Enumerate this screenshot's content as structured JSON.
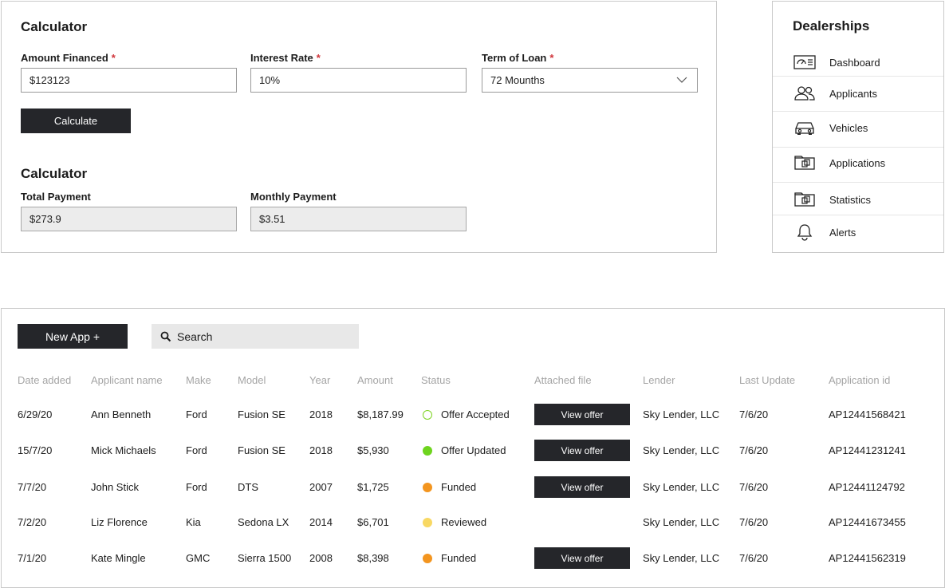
{
  "calculator": {
    "title": "Calculator",
    "amount_financed": {
      "label": "Amount Financed",
      "required_mark": "*",
      "value": "$123123"
    },
    "interest_rate": {
      "label": "Interest Rate",
      "required_mark": "*",
      "value": "10%"
    },
    "term_of_loan": {
      "label": "Term of Loan",
      "required_mark": "*",
      "value": "72 Mounths"
    },
    "calculate_label": "Calculate",
    "results_title": "Calculator",
    "total_payment": {
      "label": "Total Payment",
      "value": "$273.9"
    },
    "monthly_payment": {
      "label": "Monthly Payment",
      "value": "$3.51"
    }
  },
  "dealerships": {
    "title": "Dealerships",
    "items": [
      {
        "label": "Dashboard",
        "icon": "dashboard-icon"
      },
      {
        "label": "Applicants",
        "icon": "users-icon"
      },
      {
        "label": "Vehicles",
        "icon": "car-icon"
      },
      {
        "label": "Applications",
        "icon": "folder-icon"
      },
      {
        "label": "Statistics",
        "icon": "folder-icon"
      },
      {
        "label": "Alerts",
        "icon": "bell-icon"
      }
    ]
  },
  "applications": {
    "new_app_label": "New App +",
    "search_placeholder": "Search",
    "columns": [
      "Date added",
      "Applicant name",
      "Make",
      "Model",
      "Year",
      "Amount",
      "Status",
      "Attached file",
      "Lender",
      "Last Update",
      "Application id"
    ],
    "view_offer_label": "View offer",
    "rows": [
      {
        "date": "6/29/20",
        "name": "Ann Benneth",
        "make": "Ford",
        "model": "Fusion SE",
        "year": "2018",
        "amount": "$8,187.99",
        "status": "Offer Accepted",
        "status_color": "#7ed321",
        "status_style": "outline",
        "has_file": true,
        "lender": "Sky Lender, LLC",
        "updated": "7/6/20",
        "app_id": "AP12441568421"
      },
      {
        "date": "15/7/20",
        "name": "Mick Michaels",
        "make": "Ford",
        "model": "Fusion SE",
        "year": "2018",
        "amount": "$5,930",
        "status": "Offer Updated",
        "status_color": "#6ed41e",
        "status_style": "filled",
        "has_file": true,
        "lender": "Sky Lender, LLC",
        "updated": "7/6/20",
        "app_id": "AP12441231241"
      },
      {
        "date": "7/7/20",
        "name": "John Stick",
        "make": "Ford",
        "model": "DTS",
        "year": "2007",
        "amount": "$1,725",
        "status": "Funded",
        "status_color": "#f3951f",
        "status_style": "filled",
        "has_file": true,
        "lender": "Sky Lender, LLC",
        "updated": "7/6/20",
        "app_id": "AP12441124792"
      },
      {
        "date": "7/2/20",
        "name": "Liz Florence",
        "make": "Kia",
        "model": "Sedona LX",
        "year": "2014",
        "amount": "$6,701",
        "status": "Reviewed",
        "status_color": "#f8d863",
        "status_style": "filled",
        "has_file": false,
        "lender": "Sky Lender, LLC",
        "updated": "7/6/20",
        "app_id": "AP12441673455"
      },
      {
        "date": "7/1/20",
        "name": "Kate Mingle",
        "make": "GMC",
        "model": "Sierra 1500",
        "year": "2008",
        "amount": "$8,398",
        "status": "Funded",
        "status_color": "#f3951f",
        "status_style": "filled",
        "has_file": true,
        "lender": "Sky Lender, LLC",
        "updated": "7/6/20",
        "app_id": "AP12441562319"
      }
    ]
  }
}
